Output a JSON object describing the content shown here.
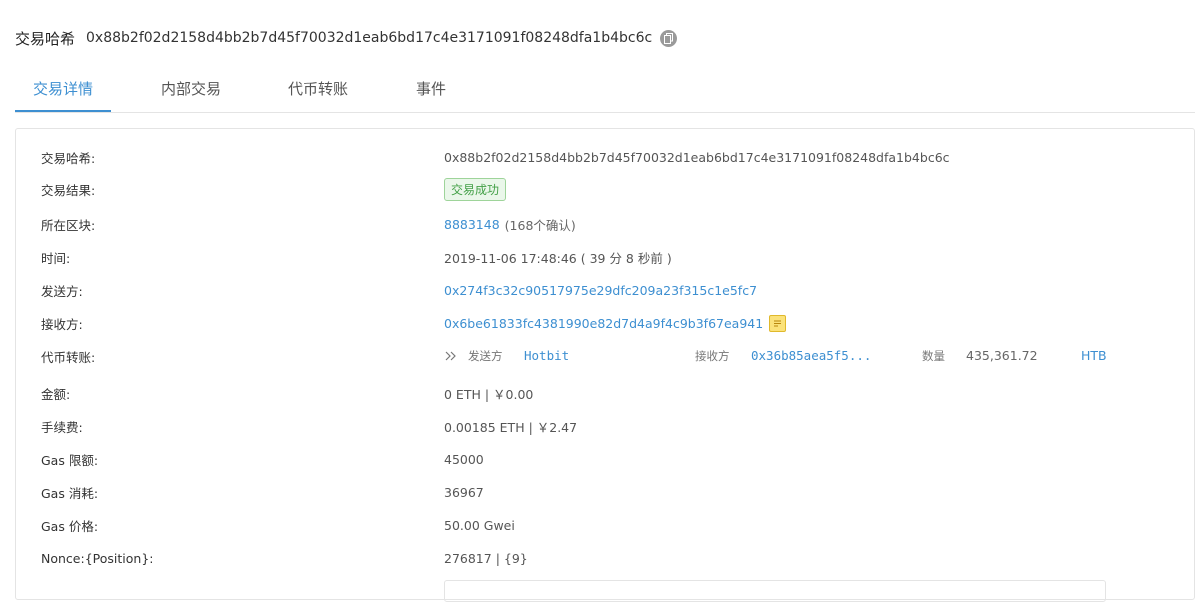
{
  "header": {
    "label": "交易哈希",
    "hash": "0x88b2f02d2158d4bb2b7d45f70032d1eab6bd17c4e3171091f08248dfa1b4bc6c"
  },
  "tabs": [
    {
      "label": "交易详情",
      "active": true
    },
    {
      "label": "内部交易",
      "active": false
    },
    {
      "label": "代币转账",
      "active": false
    },
    {
      "label": "事件",
      "active": false
    }
  ],
  "details": {
    "hash": {
      "label": "交易哈希:",
      "value": "0x88b2f02d2158d4bb2b7d45f70032d1eab6bd17c4e3171091f08248dfa1b4bc6c"
    },
    "result": {
      "label": "交易结果:",
      "value": "交易成功"
    },
    "block": {
      "label": "所在区块:",
      "number": "8883148",
      "confirmations": "(168个确认)"
    },
    "time": {
      "label": "时间:",
      "value": "2019-11-06 17:48:46 ( 39 分 8 秒前 )"
    },
    "from": {
      "label": "发送方:",
      "value": "0x274f3c32c90517975e29dfc209a23f315c1e5fc7"
    },
    "to": {
      "label": "接收方:",
      "value": "0x6be61833fc4381990e82d7d4a9f4c9b3f67ea941"
    },
    "token_transfer": {
      "label": "代币转账:",
      "from_label": "发送方",
      "from_value": "Hotbit",
      "to_label": "接收方",
      "to_value": "0x36b85aea5f5...",
      "amount_label": "数量",
      "amount": "435,361.72",
      "token": "HTB"
    },
    "amount": {
      "label": "金额:",
      "value": "0 ETH | ￥0.00"
    },
    "fee": {
      "label": "手续费:",
      "value": "0.00185 ETH | ￥2.47"
    },
    "gas_limit": {
      "label": "Gas 限额:",
      "value": "45000"
    },
    "gas_used": {
      "label": "Gas 消耗:",
      "value": "36967"
    },
    "gas_price": {
      "label": "Gas 价格:",
      "value": "50.00 Gwei"
    },
    "nonce": {
      "label": "Nonce:{Position}:",
      "value": "276817 | {9}"
    }
  },
  "colors": {
    "accent": "#3d8fd1",
    "success_text": "#43a047",
    "success_bg": "#eaf7ea",
    "note_icon": "#fbe27a"
  },
  "icons": {
    "copy": "copy-icon",
    "note": "note-icon",
    "transfer": "double-chevron-right-icon"
  }
}
